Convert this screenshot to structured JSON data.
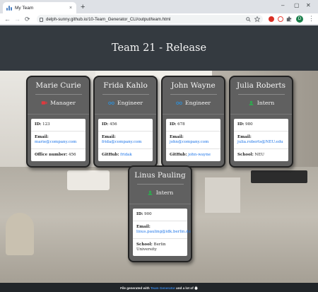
{
  "browser": {
    "tab_title": "My Team",
    "tab_close": "×",
    "new_tab": "+",
    "window_controls": {
      "minimize": "–",
      "maximize": "▢",
      "close": "✕"
    },
    "back": "←",
    "forward": "→",
    "reload": "⟳",
    "url": "delph-sunny.github.io/10-Team_Generator_CLI/output/team.html",
    "avatar_letter": "D",
    "menu": "⋮",
    "icons": [
      "lock-icon",
      "search-icon",
      "star-icon",
      "extension-icon"
    ]
  },
  "page": {
    "title": "Team 21 - Release",
    "cards": [
      {
        "name": "Marie Curie",
        "role": "Manager",
        "role_icon": "coffee-mug-icon",
        "id_label": "ID:",
        "id": "123",
        "email_label": "Email:",
        "email": "marie@company.com",
        "extra_label": "Office number:",
        "extra": "456"
      },
      {
        "name": "Frida Kahlo",
        "role": "Engineer",
        "role_icon": "glasses-icon",
        "id_label": "ID:",
        "id": "456",
        "email_label": "Email:",
        "email": "frida@company.com",
        "extra_label": "GitHub:",
        "extra": "fridak"
      },
      {
        "name": "John Wayne",
        "role": "Engineer",
        "role_icon": "glasses-icon",
        "id_label": "ID:",
        "id": "678",
        "email_label": "Email:",
        "email": "john@company.com",
        "extra_label": "GitHub:",
        "extra": "john-wayne"
      },
      {
        "name": "Julia Roberts",
        "role": "Intern",
        "role_icon": "graduate-icon",
        "id_label": "ID:",
        "id": "980",
        "email_label": "Email:",
        "email": "julia.roberts@NEU.edu",
        "extra_label": "School:",
        "extra": "NEU"
      },
      {
        "name": "Linus Pauling",
        "role": "Intern",
        "role_icon": "graduate-icon",
        "id_label": "ID:",
        "id": "900",
        "email_label": "Email:",
        "email": "linus.pauling@idk.berlin.de",
        "extra_label": "School:",
        "extra": "Berlin University"
      }
    ],
    "footer": {
      "prefix": "File generated with",
      "link": "Team Generator",
      "suffix": "and a lot of",
      "icon": "fire-icon"
    }
  },
  "colors": {
    "header_bg": "#343a40",
    "card_bg": "#606060",
    "manager_icon": "#e0393e",
    "engineer_icon": "#2f8fd6",
    "intern_icon": "#2fa94e",
    "link": "#1a73e8"
  }
}
